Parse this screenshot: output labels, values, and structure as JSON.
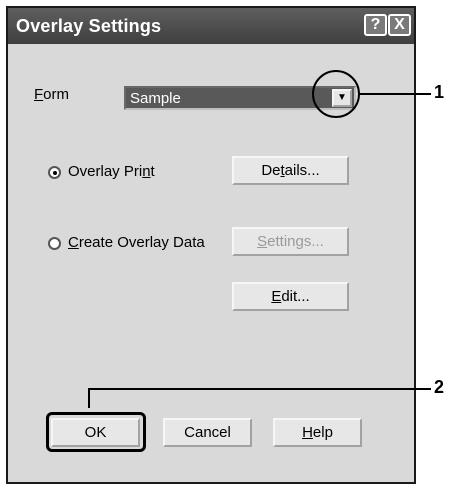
{
  "dialog": {
    "title": "Overlay Settings",
    "help_button_label": "?",
    "close_button_label": "X"
  },
  "form": {
    "label_prefix_underline": "F",
    "label_rest": "orm",
    "selected_value": "Sample",
    "dropdown_glyph": "▼"
  },
  "options": {
    "overlay_print_label_before": "Overlay Pri",
    "overlay_print_label_underline": "n",
    "overlay_print_label_after": "t",
    "overlay_print_checked": true,
    "create_overlay_label_underline": "C",
    "create_overlay_label_rest": "reate Overlay Data",
    "create_overlay_checked": false
  },
  "buttons": {
    "details_before": "De",
    "details_underline": "t",
    "details_after": "ails...",
    "settings_underline": "S",
    "settings_rest": "ettings...",
    "edit_underline": "E",
    "edit_rest": "dit...",
    "ok_label": "OK",
    "cancel_label": "Cancel",
    "help_underline": "H",
    "help_rest": "elp"
  },
  "annotations": {
    "label_1": "1",
    "label_2": "2"
  }
}
